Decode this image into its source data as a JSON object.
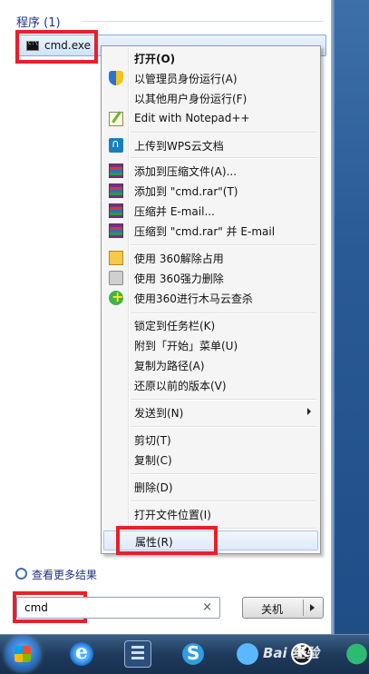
{
  "start_menu": {
    "section_header": "程序 (1)",
    "program_item": {
      "label": "cmd.exe"
    },
    "see_more": "查看更多结果",
    "search": {
      "value": "cmd",
      "clear_glyph": "×"
    },
    "shutdown": {
      "label": "关机"
    }
  },
  "context_menu": {
    "items": [
      {
        "label": "打开(O)",
        "bold": true
      },
      {
        "label": "以管理员身份运行(A)",
        "icon": "uac-shield-icon"
      },
      {
        "label": "以其他用户身份运行(F)"
      },
      {
        "label": "Edit with Notepad++",
        "icon": "notepad-plus-plus-icon"
      },
      {
        "label": "上传到WPS云文档",
        "icon": "wps-cloud-icon"
      },
      {
        "label": "添加到压缩文件(A)...",
        "icon": "winrar-icon"
      },
      {
        "label": "添加到 \"cmd.rar\"(T)",
        "icon": "winrar-icon"
      },
      {
        "label": "压缩并 E-mail...",
        "icon": "winrar-icon"
      },
      {
        "label": "压缩到 \"cmd.rar\" 并 E-mail",
        "icon": "winrar-icon"
      },
      {
        "label": "使用 360解除占用",
        "icon": "360-unlock-icon"
      },
      {
        "label": "使用 360强力删除",
        "icon": "360-shred-icon"
      },
      {
        "label": "使用360进行木马云查杀",
        "icon": "360-scan-icon"
      },
      {
        "label": "锁定到任务栏(K)"
      },
      {
        "label": "附到「开始」菜单(U)"
      },
      {
        "label": "复制为路径(A)"
      },
      {
        "label": "还原以前的版本(V)"
      },
      {
        "label": "发送到(N)",
        "submenu": true
      },
      {
        "label": "剪切(T)"
      },
      {
        "label": "复制(C)"
      },
      {
        "label": "删除(D)"
      },
      {
        "label": "打开文件位置(I)"
      },
      {
        "label": "属性(R)",
        "highlighted": true
      }
    ]
  },
  "taskbar": {
    "apps": [
      "start-orb-icon",
      "internet-explorer-icon",
      "media-film-icon",
      "sogou-s-icon",
      "swift-browser-icon",
      "k-app-icon",
      "green-app-icon"
    ],
    "watermark": "Bai 经验"
  }
}
